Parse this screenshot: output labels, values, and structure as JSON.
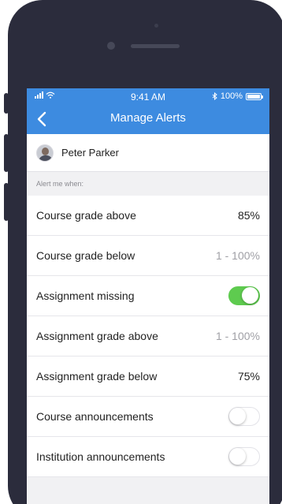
{
  "status_bar": {
    "time": "9:41 AM",
    "battery": "100%"
  },
  "nav": {
    "title": "Manage Alerts"
  },
  "user": {
    "name": "Peter Parker"
  },
  "section": {
    "label": "Alert me when:"
  },
  "alerts": [
    {
      "label": "Course grade above",
      "kind": "value",
      "value": "85%"
    },
    {
      "label": "Course grade below",
      "kind": "placeholder",
      "value": "1 - 100%"
    },
    {
      "label": "Assignment missing",
      "kind": "toggle",
      "on": true
    },
    {
      "label": "Assignment grade above",
      "kind": "placeholder",
      "value": "1 - 100%"
    },
    {
      "label": "Assignment grade below",
      "kind": "value",
      "value": "75%"
    },
    {
      "label": "Course announcements",
      "kind": "toggle",
      "on": false
    },
    {
      "label": "Institution announcements",
      "kind": "toggle",
      "on": false
    }
  ],
  "colors": {
    "nav_bar": "#3d8be0",
    "toggle_on": "#5ecb4f",
    "bezel": "#2b2c3c"
  }
}
